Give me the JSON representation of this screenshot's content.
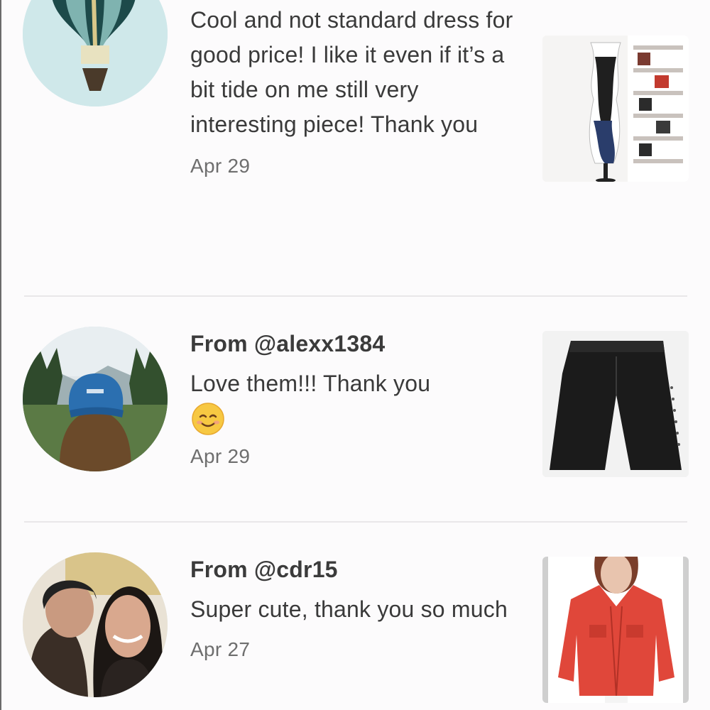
{
  "reviews": [
    {
      "from": "",
      "comment": "Cool and not standard dress for good price! I like it even if it’s a bit tide on me still very interesting piece! Thank you",
      "date": "Apr 29",
      "avatar_icon": "hot-air-balloon-avatar",
      "thumb_icon": "dress-on-mannequin-thumbnail"
    },
    {
      "from": "From @alexx1384",
      "comment": "Love them!!! Thank you",
      "emoji": "☺️",
      "date": "Apr 29",
      "avatar_icon": "person-blue-cap-mountains-avatar",
      "thumb_icon": "black-jeans-thumbnail"
    },
    {
      "from": "From @cdr15",
      "comment": "Super cute, thank you so much",
      "date": "Apr 27",
      "avatar_icon": "couple-selfie-avatar",
      "thumb_icon": "red-denim-jacket-thumbnail"
    }
  ],
  "colors": {
    "background": "#fcfbfc",
    "text": "#3a3a3a",
    "date": "#6e6e6e",
    "divider": "#e9e7e9",
    "jacket": "#e0473a"
  }
}
